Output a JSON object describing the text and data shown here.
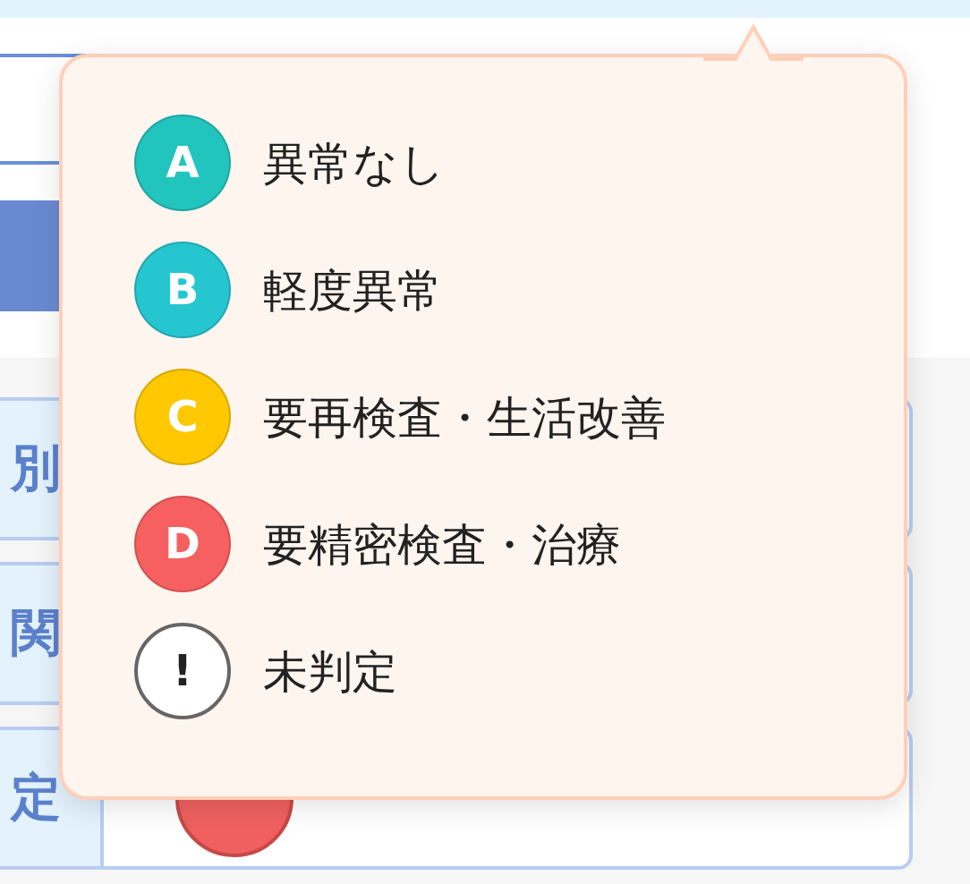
{
  "form": {
    "rows": [
      {
        "label": "別"
      },
      {
        "label": "関"
      },
      {
        "label": "定"
      }
    ],
    "grade_badge": {
      "color": "#f06060"
    }
  },
  "legend_popup": {
    "items": [
      {
        "symbol": "A",
        "text": "異常なし",
        "kind": "grade",
        "color": "#22c5bd"
      },
      {
        "symbol": "B",
        "text": "軽度異常",
        "kind": "grade",
        "color": "#26c6d0"
      },
      {
        "symbol": "C",
        "text": "要再検査・生活改善",
        "kind": "grade",
        "color": "#ffc800"
      },
      {
        "symbol": "D",
        "text": "要精密検査・治療",
        "kind": "grade",
        "color": "#f66060"
      },
      {
        "symbol": "!",
        "text": "未判定",
        "kind": "pending"
      }
    ]
  }
}
